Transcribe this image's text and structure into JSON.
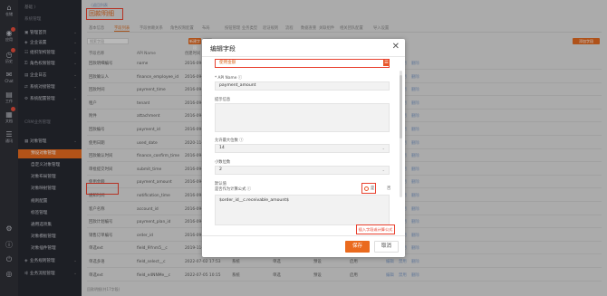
{
  "rail": {
    "items": [
      {
        "icon": "home-icon",
        "glyph": "⌂",
        "label": "仓储"
      },
      {
        "icon": "apps-icon",
        "glyph": "◉",
        "label": "应用"
      },
      {
        "icon": "history-icon",
        "glyph": "◷",
        "label": "历史"
      },
      {
        "icon": "chat-icon",
        "glyph": "✉",
        "label": "Chat"
      },
      {
        "icon": "workbench-icon",
        "glyph": "▤",
        "label": "工作"
      },
      {
        "icon": "document-icon",
        "glyph": "▦",
        "label": "文档"
      },
      {
        "icon": "contact-icon",
        "glyph": "☰",
        "label": "通讯"
      },
      {
        "icon": "settings-icon",
        "glyph": "⚙",
        "label": ""
      },
      {
        "icon": "info-icon",
        "glyph": "ⓘ",
        "label": ""
      },
      {
        "icon": "power-icon",
        "glyph": "⏻",
        "label": ""
      },
      {
        "icon": "user-icon",
        "glyph": "◎",
        "label": ""
      }
    ]
  },
  "sidebar": {
    "breadcrumb": "基础 〉",
    "items": [
      {
        "label": "系统管理",
        "icon": "",
        "kind": "sec"
      },
      {
        "label": "管理首页",
        "icon": "▣",
        "kind": "top"
      },
      {
        "label": "企业设置",
        "icon": "◈",
        "kind": "top"
      },
      {
        "label": "组织架构管理",
        "icon": "☷",
        "kind": "top"
      },
      {
        "label": "角色权限管理",
        "icon": "⚿",
        "kind": "top"
      },
      {
        "label": "企业日志",
        "icon": "▤",
        "kind": "top"
      },
      {
        "label": "系统对接管理",
        "icon": "⇄",
        "kind": "top"
      },
      {
        "label": "系统配置管理",
        "icon": "⚙",
        "kind": "top"
      },
      {
        "label": "CRM业务管理",
        "icon": "",
        "kind": "sec"
      },
      {
        "label": "对象管理",
        "icon": "▦",
        "kind": "top"
      },
      {
        "label": "预设对象管理",
        "icon": "",
        "kind": "sub-active"
      },
      {
        "label": "自定义对象管理",
        "icon": "",
        "kind": "sub"
      },
      {
        "label": "对象布局管理",
        "icon": "",
        "kind": "sub"
      },
      {
        "label": "对象映射管理",
        "icon": "",
        "kind": "sub"
      },
      {
        "label": "规则配置",
        "icon": "",
        "kind": "sub"
      },
      {
        "label": "标签管理",
        "icon": "",
        "kind": "sub"
      },
      {
        "label": "通用选项集",
        "icon": "",
        "kind": "sub"
      },
      {
        "label": "对象模板管理",
        "icon": "",
        "kind": "sub"
      },
      {
        "label": "对象插件管理",
        "icon": "",
        "kind": "sub"
      },
      {
        "label": "业务规则管理",
        "icon": "◈",
        "kind": "top"
      },
      {
        "label": "业务流程管理",
        "icon": "⇶",
        "kind": "top"
      }
    ]
  },
  "page": {
    "back_link": "〈返回列表",
    "title": "回款明细",
    "tabs": [
      "基本信息",
      "字段列表",
      "字段依赖关系",
      "角色权限配置",
      "布局",
      "按钮管理",
      "业务类型",
      "验证规则",
      "流程",
      "数据查重",
      "关联组件",
      "相关团队配置",
      "导入设置"
    ],
    "active_tab": 1,
    "search_placeholder": "搜索字段",
    "btn_new": "新建字段",
    "btn_export": "导出",
    "btn_right": "添加字段",
    "columns": [
      "字段名称",
      "API Name",
      "创建时间",
      "创建人",
      "字段类型",
      "是否自定义",
      "状态",
      "操作"
    ],
    "rows": [
      [
        "回款明细编号",
        "name",
        "2016-09-10 10:2"
      ],
      [
        "回款确认人",
        "finance_employee_id",
        "2016-09-10 10:2"
      ],
      [
        "回款时间",
        "payment_time",
        "2016-09-10 10:2"
      ],
      [
        "租户",
        "tenant",
        "2016-09-10 10:2"
      ],
      [
        "附件",
        "attachment",
        "2016-09-10 10:2"
      ],
      [
        "回款编号",
        "payment_id",
        "2016-09-10 10:2"
      ],
      [
        "使用日期",
        "used_date",
        "2020-11-11 15:"
      ],
      [
        "回款确认时间",
        "finance_confirm_time",
        "2016-09-10 10:2"
      ],
      [
        "审批提交时间",
        "submit_time",
        "2016-09-10 10:2"
      ],
      [
        "使用金额",
        "payment_amount",
        "2016-09-10 10:2"
      ],
      [
        "通知时间",
        "notification_time",
        "2016-09-10 10:2"
      ],
      [
        "客户名称",
        "account_id",
        "2016-09-10 10:2"
      ],
      [
        "回款计划编号",
        "payment_plan_id",
        "2016-09-10 10:2"
      ],
      [
        "销售订单编号",
        "order_id",
        "2016-09-10 10:2"
      ],
      [
        "单选ext",
        "field_9Ynm5__c",
        "2019-11-11 15:",
        "系统",
        "单选",
        "预设",
        "启用"
      ],
      [
        "单选多语",
        "field_select__c",
        "2022-07-02 17:53",
        "系统",
        "单选",
        "预设",
        "启用"
      ],
      [
        "单选ext",
        "field_e4NNMe__c",
        "2022-07-05 10:15",
        "系统",
        "单选",
        "预设",
        "启用"
      ]
    ],
    "row_actions": [
      "编辑",
      "禁用",
      "删除"
    ],
    "footer": "回款明细(共17字段)"
  },
  "modal": {
    "title": "编辑字段",
    "name_value": "使用金额",
    "api_label": "* API Name ⓘ",
    "api_value": "payment_amount",
    "hint_label": "提示信息",
    "decimal_label": "允许最大位数 ⓘ",
    "decimal_value": "14",
    "precision_label": "小数位数",
    "precision_value": "2",
    "default_label": "默认值",
    "formula_label": "是否作为计算公式 ⓘ",
    "radio_yes": "是",
    "radio_no": "否",
    "formula_value": "$order_id__c.receivable_amount$",
    "insert_formula": "插入字段或计算公式",
    "save": "保存",
    "cancel": "取消"
  },
  "colors": {
    "accent": "#ea6a1e",
    "highlight": "#e8402e"
  }
}
